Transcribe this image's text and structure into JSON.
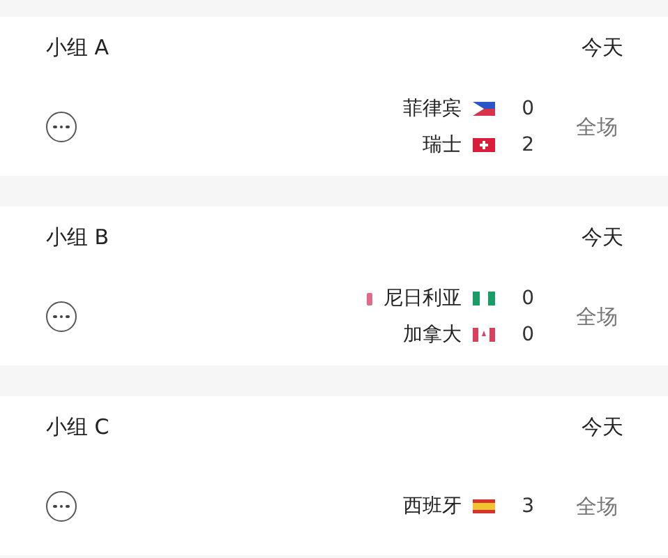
{
  "groups": [
    {
      "title": "小组 A",
      "date": "今天",
      "status": "全场",
      "teams": [
        {
          "name": "菲律宾",
          "kind": "ph",
          "score": "0",
          "tagged": false
        },
        {
          "name": "瑞士",
          "kind": "ch",
          "score": "2",
          "tagged": false
        }
      ]
    },
    {
      "title": "小组 B",
      "date": "今天",
      "status": "全场",
      "teams": [
        {
          "name": "尼日利亚",
          "kind": "ng",
          "score": "0",
          "tagged": true
        },
        {
          "name": "加拿大",
          "kind": "ca",
          "score": "0",
          "tagged": false
        }
      ]
    },
    {
      "title": "小组 C",
      "date": "今天",
      "status": "全场",
      "teams": [
        {
          "name": "西班牙",
          "kind": "es",
          "score": "3",
          "tagged": false
        }
      ]
    }
  ]
}
